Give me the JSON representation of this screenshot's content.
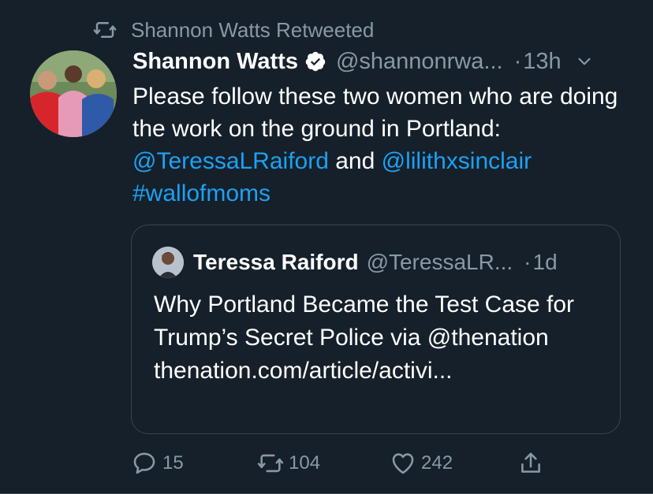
{
  "retweet_context": {
    "icon": "retweet-icon",
    "text": "Shannon Watts Retweeted"
  },
  "tweet": {
    "author_name": "Shannon Watts",
    "verified": true,
    "handle": "@shannonrwa...",
    "separator": "·",
    "time": "13h",
    "text_parts": [
      {
        "text": "Please follow these two women who are doing the work on the ground in Portland: ",
        "type": "plain"
      },
      {
        "text": "@TeressaLRaiford",
        "type": "mention"
      },
      {
        "text": " and ",
        "type": "plain"
      },
      {
        "text": "@lilithxsinclair",
        "type": "mention"
      },
      {
        "text": " ",
        "type": "plain"
      },
      {
        "text": "#wallofmoms",
        "type": "hashtag"
      }
    ]
  },
  "quoted_tweet": {
    "author_name": "Teressa Raiford",
    "handle": "@TeressaLR...",
    "separator": "·",
    "time": "1d",
    "text": "Why Portland Became the Test Case for Trump’s Secret Police via @thenation thenation.com/article/activi..."
  },
  "actions": {
    "reply_count": "15",
    "retweet_count": "104",
    "like_count": "242"
  },
  "colors": {
    "background": "#15202b",
    "link": "#1da1f2",
    "secondary_text": "#8899a6",
    "border": "#38444d"
  }
}
